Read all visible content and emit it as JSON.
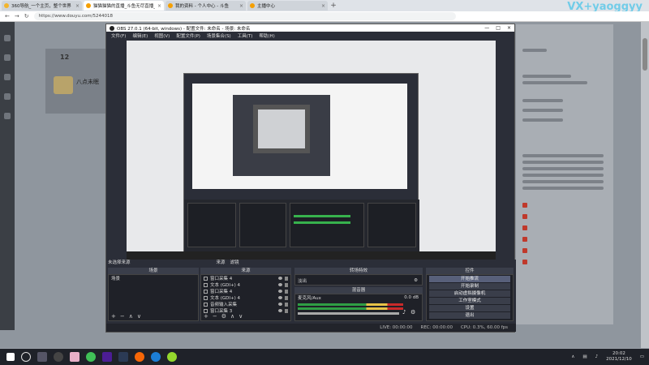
{
  "browser": {
    "tabs": [
      {
        "label": "360导航_一个主页，整个世界",
        "color": "#f3b52c",
        "active": false
      },
      {
        "label": "猫猫猫猫的直播_斗鱼无尽直播_",
        "color": "#f59f00",
        "active": true
      },
      {
        "label": "我的资料 - 个人中心 - 斗鱼",
        "color": "#f59f00",
        "active": false
      },
      {
        "label": "主播中心",
        "color": "#f59f00",
        "active": false
      }
    ],
    "url": "https://www.douyu.com/5244018",
    "watermark": "VX+yaoggyy"
  },
  "page": {
    "streamer_count": "12",
    "streamer_name": "八点未眠"
  },
  "obs": {
    "title": "OBS 27.0.1 (64-bit, windows) - 配置文件: 未命名 - 场景: 未命名",
    "menu": [
      "文件(F)",
      "编辑(E)",
      "视图(V)",
      "配置文件(P)",
      "场景集合(S)",
      "工具(T)",
      "帮助(H)"
    ],
    "source_tabs": [
      "来源",
      "滤镜"
    ],
    "docks": {
      "scenes_label": "场景",
      "sources_label": "来源",
      "mixer_label": "混音器",
      "transitions_label": "转场特效",
      "controls_label": "控件"
    },
    "panel_label": "未选择来源",
    "scenes": [
      "场景"
    ],
    "sources": [
      {
        "name": "窗口采集 4",
        "icon": "window-icon"
      },
      {
        "name": "文本 (GDI+) 4",
        "icon": "text-icon"
      },
      {
        "name": "窗口采集 4",
        "icon": "window-icon"
      },
      {
        "name": "文本 (GDI+) 4",
        "icon": "text-icon"
      },
      {
        "name": "音频输入采集",
        "icon": "mic-icon"
      },
      {
        "name": "窗口采集 3",
        "icon": "window-icon"
      }
    ],
    "transition": "淡出",
    "mixer_channel": "麦克风/Aux",
    "mixer_db": "0.0 dB",
    "controls": [
      "开始推流",
      "开始录制",
      "启动虚拟摄像机",
      "工作室模式",
      "设置",
      "退出"
    ],
    "status": {
      "live": "LIVE: 00:00:00",
      "rec": "REC: 00:00:00",
      "cpu": "CPU: 0.3%, 60.00 fps"
    }
  },
  "taskbar": {
    "time": "20:02",
    "date": "2021/12/10"
  }
}
